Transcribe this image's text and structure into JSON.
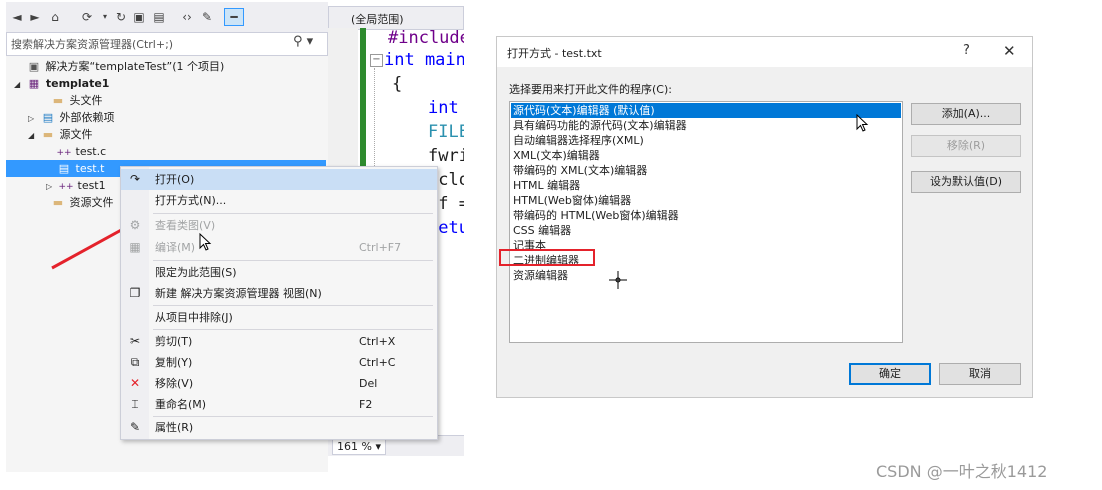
{
  "solution_explorer": {
    "search_placeholder": "搜索解决方案资源管理器(Ctrl+;)",
    "tree": [
      {
        "label": "解决方案“templateTest”(1 个项目)",
        "icon": "solution-icon"
      },
      {
        "label": "template1",
        "icon": "project-icon"
      },
      {
        "label": "头文件",
        "icon": "folder-icon"
      },
      {
        "label": "外部依赖项",
        "icon": "dependencies-icon"
      },
      {
        "label": "源文件",
        "icon": "folder-icon"
      },
      {
        "label": "test.c",
        "icon": "c-file-icon"
      },
      {
        "label": "test.t",
        "icon": "text-file-icon"
      },
      {
        "label": "test1",
        "icon": "c-file-icon"
      },
      {
        "label": "资源文件",
        "icon": "folder-icon"
      }
    ]
  },
  "code_editor": {
    "scope": "(全局范围)",
    "lines": [
      "#include",
      "int main",
      "{",
      "int",
      "FILE",
      "fwri",
      "fclo",
      "pf =",
      "retu"
    ],
    "zoom": "161 %"
  },
  "context_menu": {
    "items": [
      {
        "label": "打开(O)",
        "shortcut": "",
        "icon": "open-icon",
        "enabled": true
      },
      {
        "label": "打开方式(N)...",
        "shortcut": "",
        "icon": "",
        "enabled": true
      },
      {
        "label": "查看类图(V)",
        "shortcut": "",
        "icon": "class-diagram-icon",
        "enabled": false
      },
      {
        "label": "编译(M)",
        "shortcut": "Ctrl+F7",
        "icon": "compile-icon",
        "enabled": false
      },
      {
        "label": "限定为此范围(S)",
        "shortcut": "",
        "icon": "",
        "enabled": true
      },
      {
        "label": "新建 解决方案资源管理器 视图(N)",
        "shortcut": "",
        "icon": "new-view-icon",
        "enabled": true
      },
      {
        "label": "从项目中排除(J)",
        "shortcut": "",
        "icon": "",
        "enabled": true
      },
      {
        "label": "剪切(T)",
        "shortcut": "Ctrl+X",
        "icon": "cut-icon",
        "enabled": true
      },
      {
        "label": "复制(Y)",
        "shortcut": "Ctrl+C",
        "icon": "copy-icon",
        "enabled": true
      },
      {
        "label": "移除(V)",
        "shortcut": "Del",
        "icon": "remove-icon",
        "enabled": true
      },
      {
        "label": "重命名(M)",
        "shortcut": "F2",
        "icon": "rename-icon",
        "enabled": true
      },
      {
        "label": "属性(R)",
        "shortcut": "",
        "icon": "properties-icon",
        "enabled": true
      }
    ]
  },
  "open_with_dialog": {
    "title": "打开方式 - test.txt",
    "help": "?",
    "close": "✕",
    "prompt": "选择要用来打开此文件的程序(C):",
    "programs": [
      "源代码(文本)编辑器 (默认值)",
      "具有编码功能的源代码(文本)编辑器",
      "自动编辑器选择程序(XML)",
      "XML(文本)编辑器",
      "带编码的 XML(文本)编辑器",
      "HTML 编辑器",
      "HTML(Web窗体)编辑器",
      "带编码的 HTML(Web窗体)编辑器",
      "CSS 编辑器",
      "记事本",
      "二进制编辑器",
      "资源编辑器"
    ],
    "selected_index": 0,
    "highlighted_index": 10,
    "buttons": {
      "add": "添加(A)...",
      "remove": "移除(R)",
      "set_default": "设为默认值(D)",
      "ok": "确定",
      "cancel": "取消"
    }
  },
  "watermark": "CSDN @一叶之秋1412",
  "colors": {
    "selection_blue": "#3399ff",
    "list_selection": "#0078d7",
    "annotation_red": "#e4222b",
    "menu_highlight": "#c9def5",
    "code_keyword_blue": "#0000ff",
    "code_type_teal": "#2b91af",
    "code_macro_purple": "#6f008a"
  }
}
